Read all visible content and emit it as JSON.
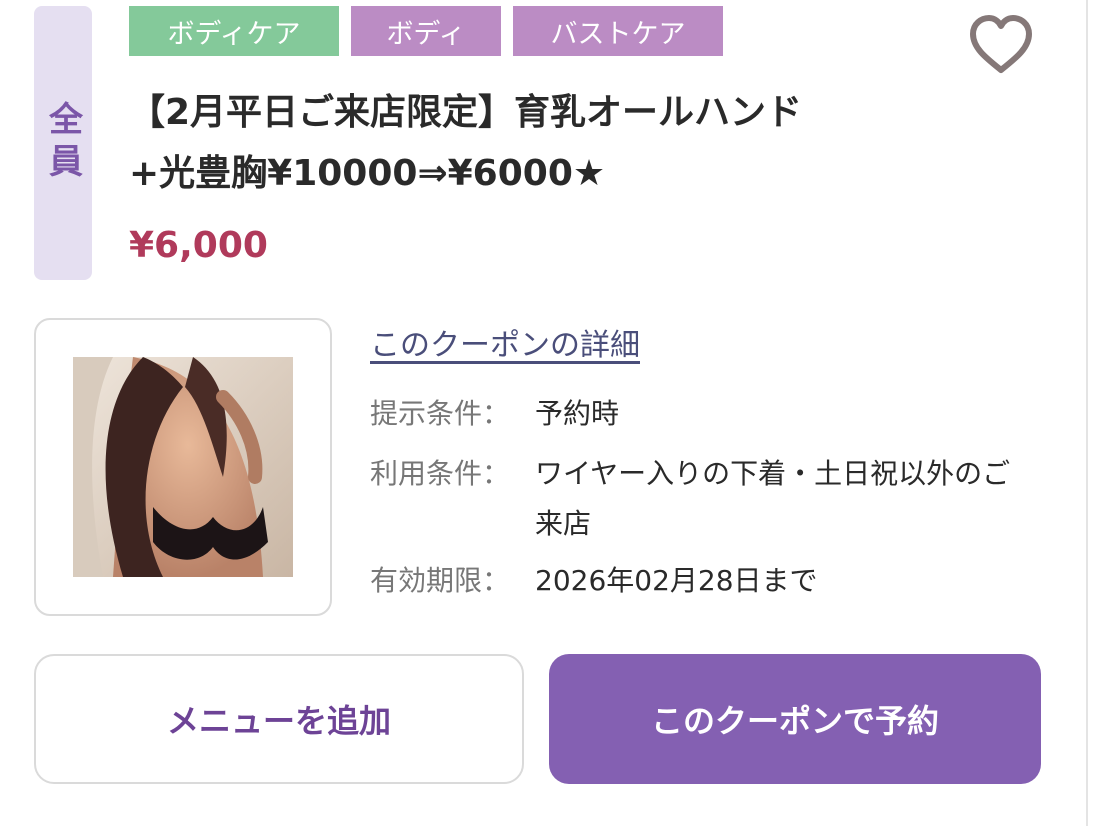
{
  "badge": {
    "target_label": "全員"
  },
  "tags": [
    {
      "label": "ボディケア",
      "color": "#84c99a"
    },
    {
      "label": "ボディ",
      "color": "#bb8cc4"
    },
    {
      "label": "バストケア",
      "color": "#bb8cc4"
    }
  ],
  "favorite": {
    "icon": "heart-outline-icon"
  },
  "coupon": {
    "title_line1": "【2月平日ご来店限定】育乳オールハンド",
    "title_line2": "+光豊胸¥10000⇒¥6000★",
    "price": "¥6,000",
    "price_color": "#b03a5b"
  },
  "details": {
    "link_label": "このクーポンの詳細",
    "rows": [
      {
        "label": "提示条件：",
        "value": "予約時"
      },
      {
        "label": "利用条件：",
        "value": "ワイヤー入りの下着・土日祝以外のご来店"
      },
      {
        "label": "有効期限：",
        "value": "2026年02月28日まで"
      }
    ]
  },
  "actions": {
    "add_menu_label": "メニューを追加",
    "reserve_label": "このクーポンで予約",
    "accent_color": "#8460b2"
  }
}
